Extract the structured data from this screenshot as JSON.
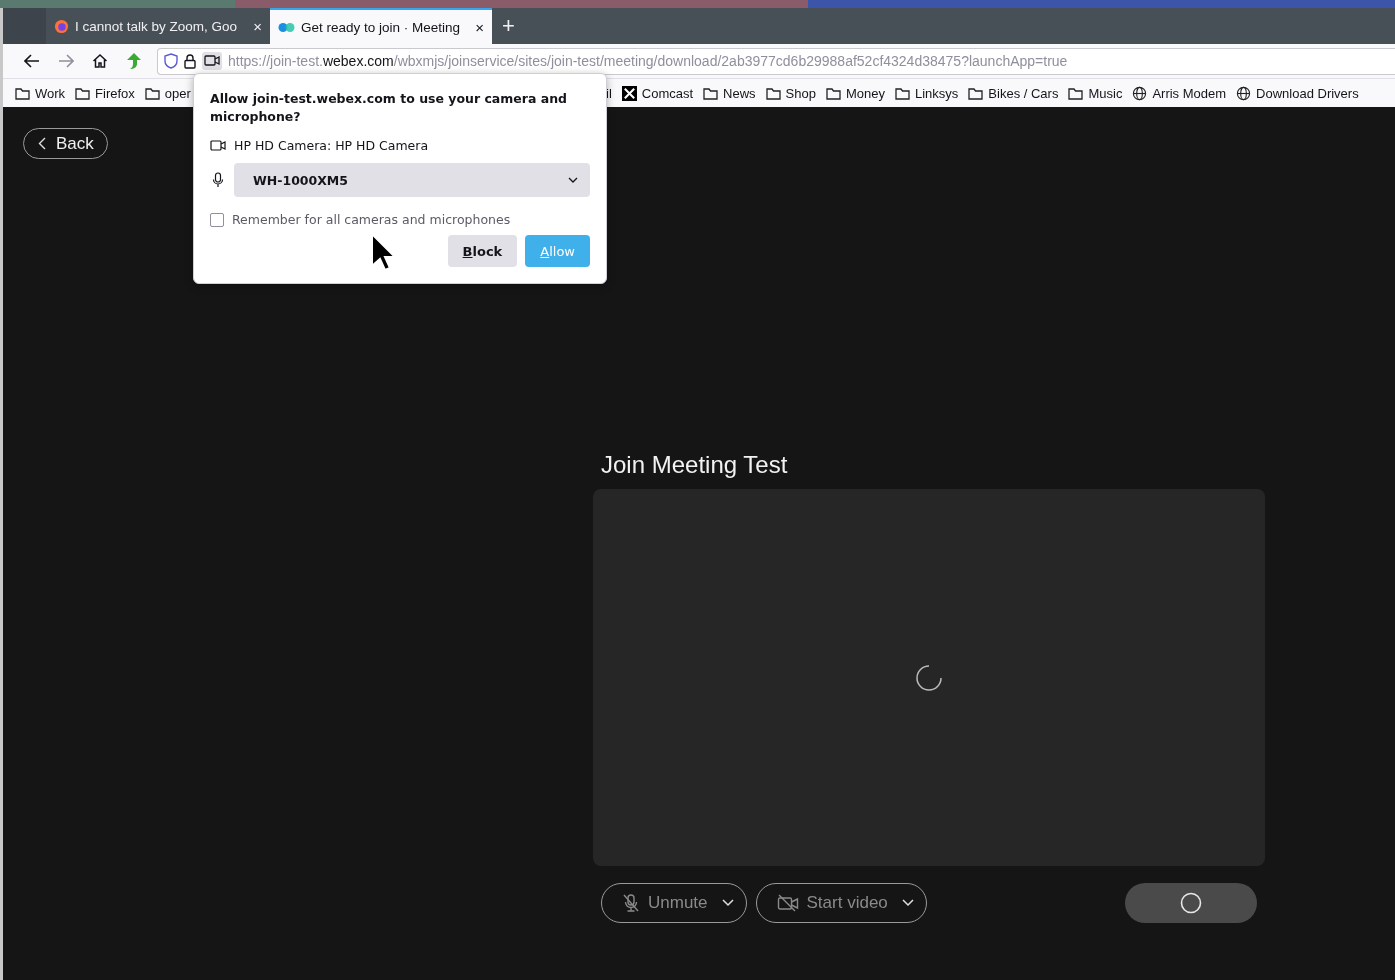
{
  "tabs": [
    {
      "title": "I cannot talk by Zoom, Goo",
      "kind": "firefox",
      "close": "×",
      "selected": false
    },
    {
      "title": "Get ready to join · Meeting",
      "kind": "webex",
      "close": "×",
      "selected": true
    }
  ],
  "new_tab": "+",
  "url": {
    "prefix": "https://join-test.",
    "domain": "webex.com",
    "path": "/wbxmjs/joinservice/sites/join-test/meeting/download/2ab3977cd6b29988af52cf4324d38475?launchApp=true"
  },
  "bookmarks": [
    {
      "label": "Work",
      "kind": "folder"
    },
    {
      "label": "Firefox",
      "kind": "folder"
    },
    {
      "label": "oper",
      "kind": "folder"
    },
    {
      "label": "il",
      "kind": "covered"
    },
    {
      "label": "Comcast",
      "kind": "x"
    },
    {
      "label": "News",
      "kind": "folder"
    },
    {
      "label": "Shop",
      "kind": "folder"
    },
    {
      "label": "Money",
      "kind": "folder"
    },
    {
      "label": "Linksys",
      "kind": "folder"
    },
    {
      "label": "Bikes / Cars",
      "kind": "folder"
    },
    {
      "label": "Music",
      "kind": "folder"
    },
    {
      "label": "Arris Modem",
      "kind": "globe"
    },
    {
      "label": "Download Drivers",
      "kind": "globe"
    }
  ],
  "permission_prompt": {
    "title": "Allow join-test.webex.com to use your camera and microphone?",
    "camera": "HP HD Camera: HP HD Camera",
    "microphone": "WH-1000XM5",
    "remember": {
      "label": "Remember for all cameras and microphones",
      "checked": false
    },
    "buttons": [
      {
        "label": "Block",
        "kind": "secondary"
      },
      {
        "label": "Allow",
        "kind": "primary"
      }
    ]
  },
  "page": {
    "back": "Back",
    "title": "Join Meeting Test",
    "controls": [
      {
        "label": "Unmute",
        "kind": "mic"
      },
      {
        "label": "Start video",
        "kind": "video"
      }
    ]
  }
}
